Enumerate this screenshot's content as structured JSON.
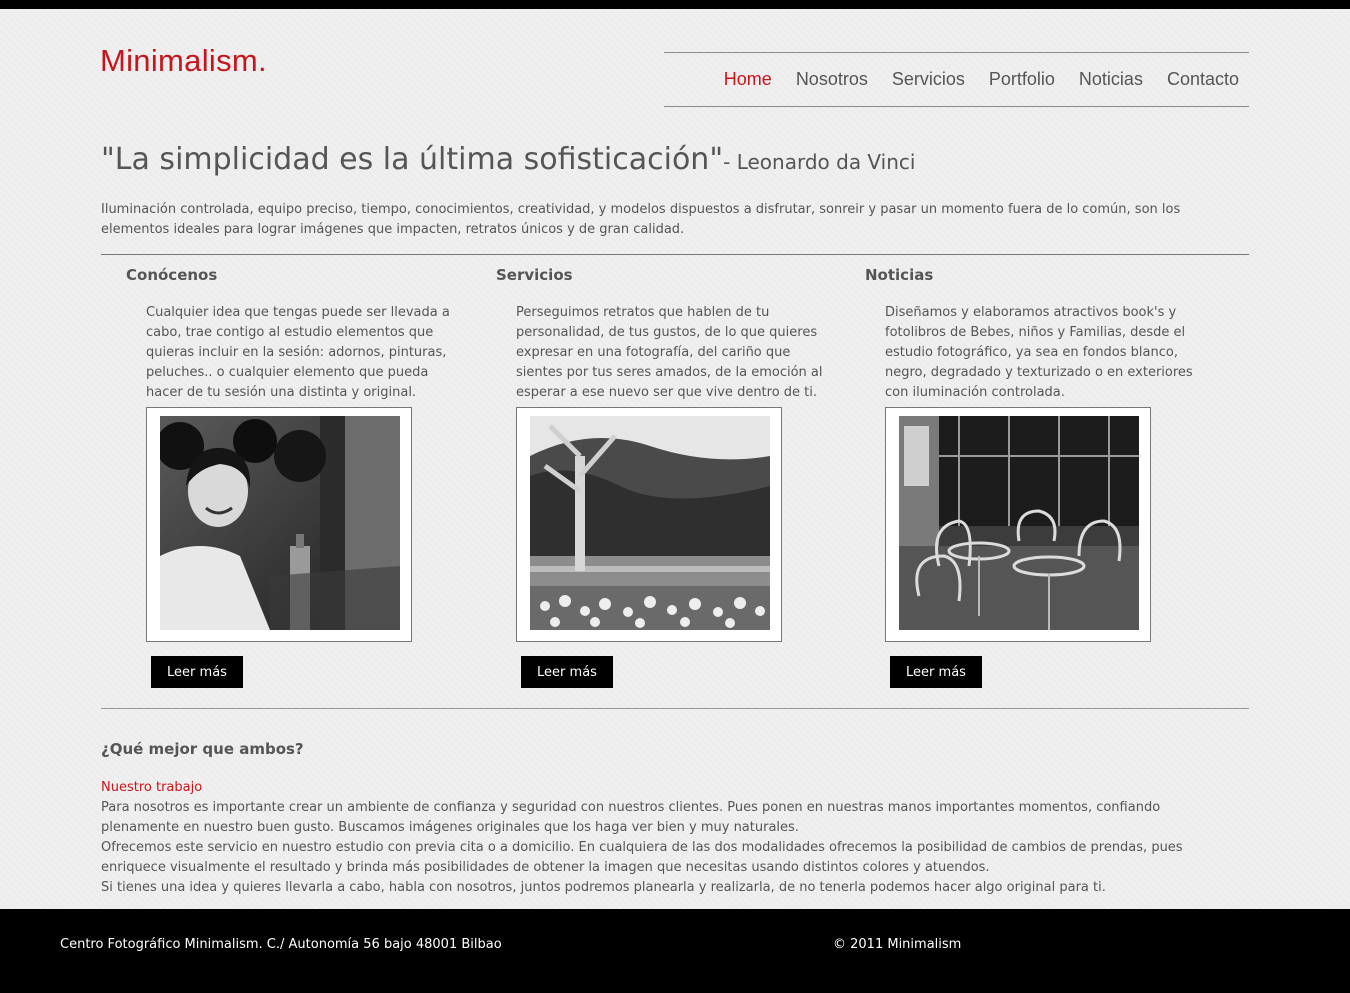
{
  "brand": {
    "logo": "Minimalism."
  },
  "nav": {
    "items": [
      {
        "label": "Home",
        "active": true
      },
      {
        "label": "Nosotros"
      },
      {
        "label": "Servicios"
      },
      {
        "label": "Portfolio"
      },
      {
        "label": "Noticias"
      },
      {
        "label": "Contacto"
      }
    ]
  },
  "hero": {
    "quote": "\"La simplicidad es la última sofisticación\"",
    "author": "- Leonardo da Vinci",
    "intro": "Iluminación controlada, equipo preciso, tiempo, conocimientos, creatividad, y modelos dispuestos a disfrutar, sonreir y pasar un momento fuera de lo común, son los elementos ideales para lograr imágenes que impacten, retratos únicos y de gran calidad."
  },
  "columns": [
    {
      "title": "Conócenos",
      "text": "Cualquier idea que tengas puede ser llevada a cabo, trae contigo al estudio elementos que quieras incluir en la sesión: adornos, pinturas, peluches.. o cualquier elemento que pueda hacer de tu sesión una distinta y original.",
      "button": "Leer más"
    },
    {
      "title": "Servicios",
      "text": "Perseguimos retratos que hablen de tu personalidad, de tus gustos, de lo que quieres expresar en una fotografía, del cariño que sientes por tus seres amados, de la emoción al esperar a ese nuevo ser que vive dentro de ti.",
      "button": "Leer más"
    },
    {
      "title": "Noticias",
      "text": "Diseñamos y elaboramos atractivos book's y fotolibros de Bebes, niños y Familias, desde el estudio fotográfico, ya sea en fondos blanco, negro, degradado y texturizado o en exteriores con iluminación controlada.",
      "button": "Leer más"
    }
  ],
  "bottom": {
    "title": "¿Qué mejor que ambos?",
    "subtitle": "Nuestro trabajo",
    "paragraphs": [
      "Para nosotros es importante crear un ambiente de confianza y seguridad con nuestros clientes. Pues ponen en nuestras manos importantes momentos, confiando plenamente en nuestro buen gusto. Buscamos imágenes originales que los haga ver bien y muy naturales.",
      "Ofrecemos este servicio en nuestro estudio con previa cita o a domicilio. En cualquiera de las dos modalidades ofrecemos la posibilidad de cambios de prendas, pues enriquece visualmente el resultado y brinda más posibilidades de obtener la imagen que necesitas usando distintos colores y atuendos.",
      "Si tienes una idea y quieres llevarla a cabo, habla con nosotros, juntos podremos planearla y realizarla, de no tenerla podemos hacer algo original para ti."
    ]
  },
  "footer": {
    "address": "Centro Fotográfico Minimalism. C./ Autonomía 56 bajo 48001 Bilbao",
    "copyright": "© 2011 Minimalism"
  },
  "colors": {
    "accent": "#c4161c",
    "text": "#555555",
    "footer_bg": "#000000"
  }
}
